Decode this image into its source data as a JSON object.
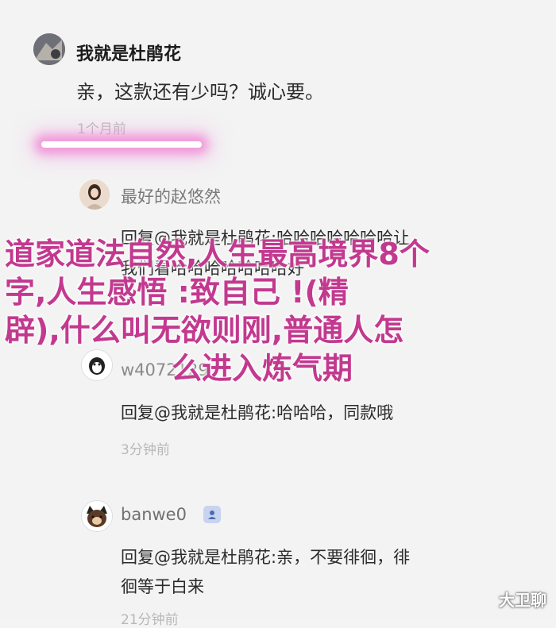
{
  "top_faded_text": "",
  "main_comment": {
    "username": "我就是杜鹃花",
    "text": "亲，这款还有少吗？诚心要。",
    "time": "1个月前"
  },
  "replies": [
    {
      "username": "最好的赵悠然",
      "text_line1": "回复@我就是杜鹃花:哈哈哈哈哈哈哈让",
      "text_line2": "我们看哈哈哈哈哈哈哈好"
    },
    {
      "username": "w4072129",
      "text": "回复@我就是杜鹃花:哈哈哈，同款哦",
      "time": "3分钟前"
    },
    {
      "username": "banwe0",
      "text_line1": "回复@我就是杜鹃花:亲，不要徘徊，徘",
      "text_line2": "徊等于白来",
      "time": "21分钟前"
    }
  ],
  "overlay_title": {
    "line1": "道家道法自然,人生最高境界8个",
    "line2": "字,人生感悟 :致自己 !(精",
    "line3": "辟),什么叫无欲则刚,普通人怎",
    "line4": "么进入炼气期"
  },
  "watermark": "大卫聊",
  "colors": {
    "overlay_title": "#c2398f",
    "glow": "#f082d2",
    "vip_badge": "#c7d3ef"
  },
  "icons": {
    "vip_badge": "verified-user-icon"
  }
}
